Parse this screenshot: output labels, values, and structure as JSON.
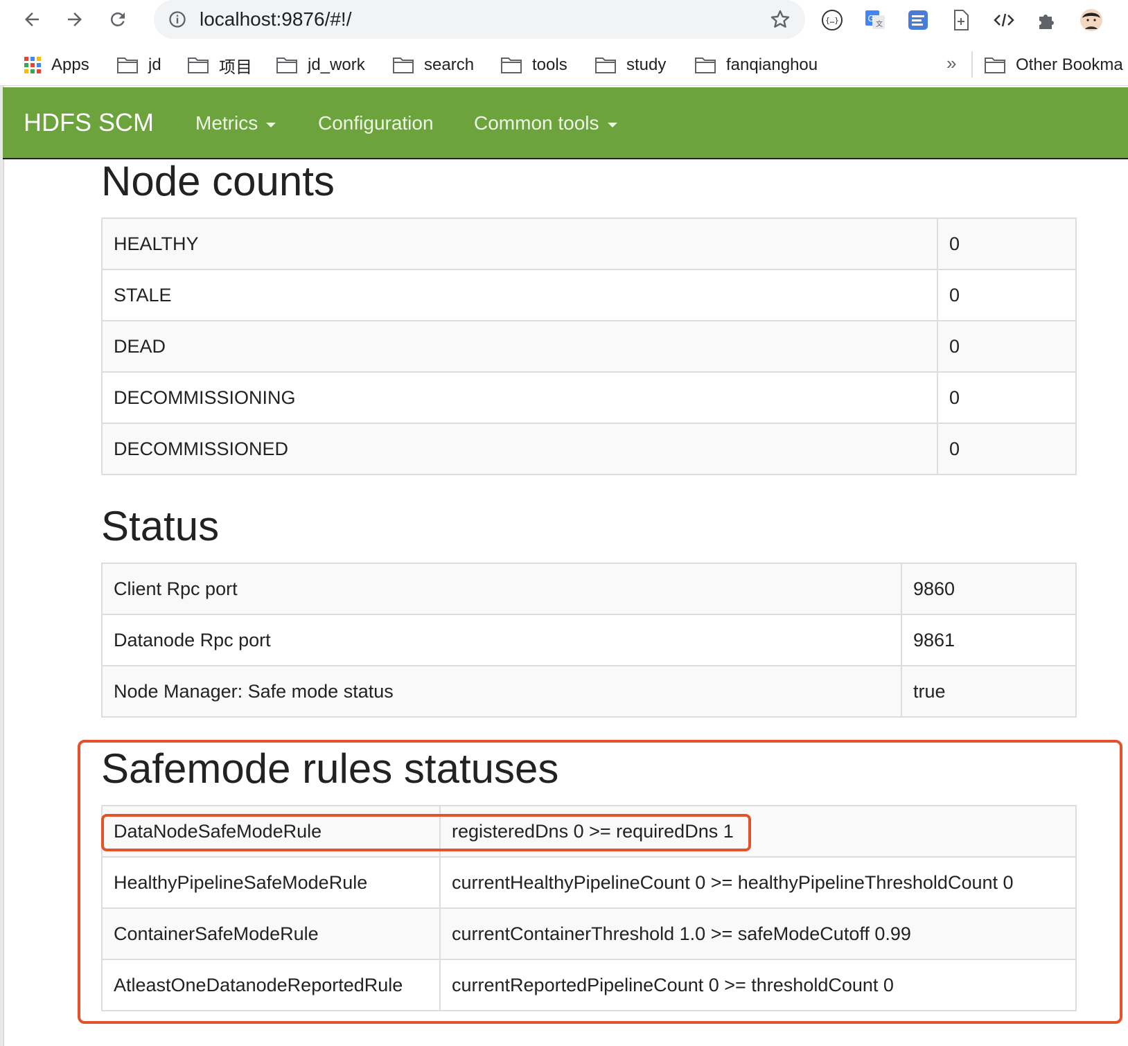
{
  "browser": {
    "url": "localhost:9876/#!/",
    "nav_icons": [
      "back-arrow-icon",
      "forward-arrow-icon",
      "reload-icon"
    ],
    "extension_icons": [
      "json-viewer-icon",
      "google-translate-icon",
      "notes-icon",
      "file-add-icon",
      "code-icon",
      "puzzle-icon",
      "profile-avatar-icon"
    ],
    "bookmarks": [
      {
        "label": "Apps",
        "icon": "apps-grid-icon"
      },
      {
        "label": "jd",
        "icon": "folder-icon"
      },
      {
        "label": "项目",
        "icon": "folder-icon"
      },
      {
        "label": "jd_work",
        "icon": "folder-icon"
      },
      {
        "label": "search",
        "icon": "folder-icon"
      },
      {
        "label": "tools",
        "icon": "folder-icon"
      },
      {
        "label": "study",
        "icon": "folder-icon"
      },
      {
        "label": "fanqianghou",
        "icon": "folder-icon"
      }
    ],
    "bookmarks_overflow": "»",
    "other_bookmarks": "Other Bookma"
  },
  "navbar": {
    "brand": "HDFS SCM",
    "links": [
      {
        "label": "Metrics",
        "dropdown": true
      },
      {
        "label": "Configuration",
        "dropdown": false
      },
      {
        "label": "Common tools",
        "dropdown": true
      }
    ],
    "color": "#6ca33d"
  },
  "node_counts": {
    "title": "Node counts",
    "rows": [
      {
        "label": "HEALTHY",
        "value": "0"
      },
      {
        "label": "STALE",
        "value": "0"
      },
      {
        "label": "DEAD",
        "value": "0"
      },
      {
        "label": "DECOMMISSIONING",
        "value": "0"
      },
      {
        "label": "DECOMMISSIONED",
        "value": "0"
      }
    ]
  },
  "status": {
    "title": "Status",
    "rows": [
      {
        "label": "Client Rpc port",
        "value": "9860"
      },
      {
        "label": "Datanode Rpc port",
        "value": "9861"
      },
      {
        "label": "Node Manager: Safe mode status",
        "value": "true"
      }
    ]
  },
  "safemode": {
    "title": "Safemode rules statuses",
    "rows": [
      {
        "label": "DataNodeSafeModeRule",
        "value": "registeredDns 0 >= requiredDns 1"
      },
      {
        "label": "HealthyPipelineSafeModeRule",
        "value": "currentHealthyPipelineCount 0 >= healthyPipelineThresholdCount 0"
      },
      {
        "label": "ContainerSafeModeRule",
        "value": "currentContainerThreshold 1.0 >= safeModeCutoff 0.99"
      },
      {
        "label": "AtleastOneDatanodeReportedRule",
        "value": "currentReportedPipelineCount 0 >= thresholdCount 0"
      }
    ]
  },
  "highlight_color": "#e4522c"
}
